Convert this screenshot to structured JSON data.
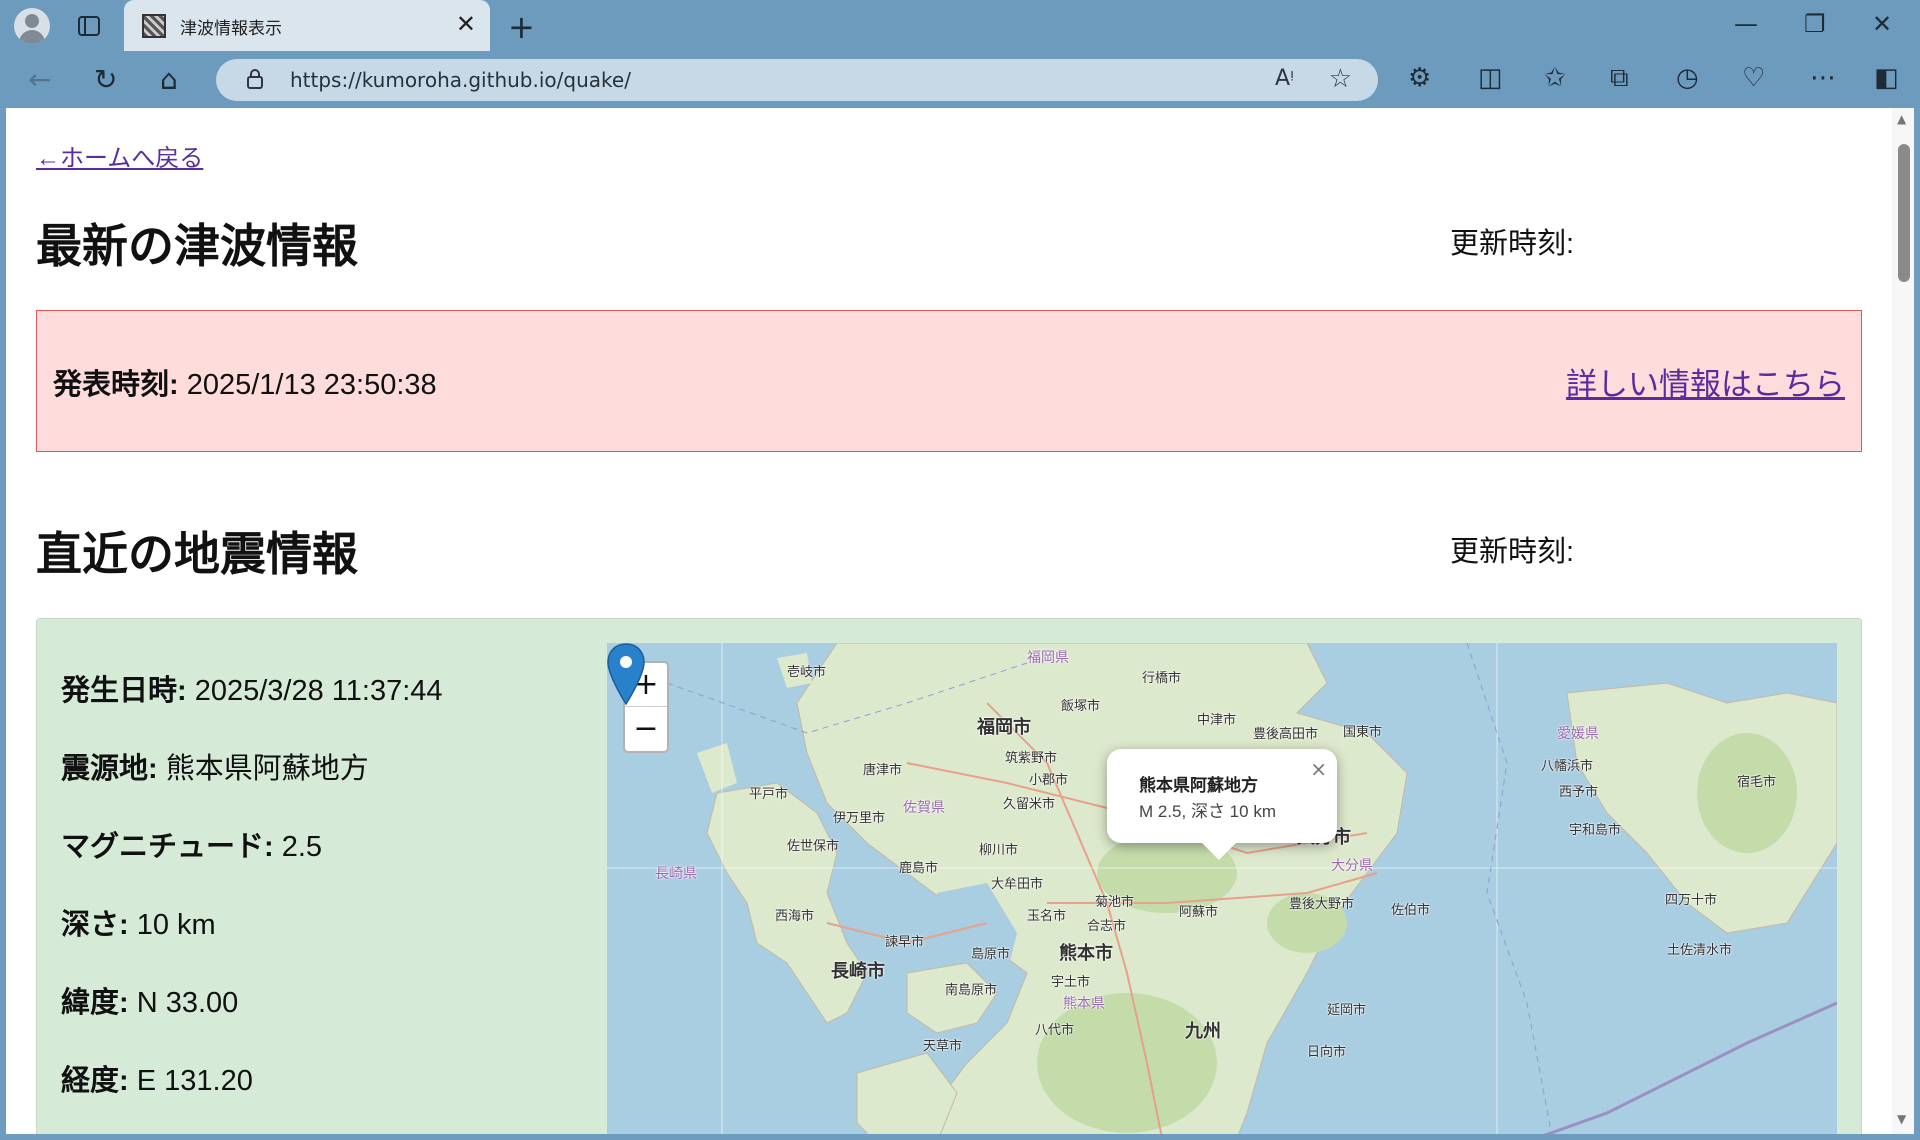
{
  "browser": {
    "tab_title": "津波情報表示",
    "url": "https://kumoroha.github.io/quake/"
  },
  "page": {
    "back_link": "←ホームへ戻る",
    "tsunami": {
      "heading": "最新の津波情報",
      "updated_label": "更新時刻:",
      "issued_label": "発表時刻:",
      "issued_value": "2025/1/13 23:50:38",
      "details_link": "詳しい情報はこちら"
    },
    "quake": {
      "heading": "直近の地震情報",
      "updated_label": "更新時刻:",
      "occurred_label": "発生日時:",
      "occurred_value": "2025/3/28 11:37:44",
      "epicenter_label": "震源地:",
      "epicenter_value": "熊本県阿蘇地方",
      "magnitude_label": "マグニチュード:",
      "magnitude_value": "2.5",
      "depth_label": "深さ:",
      "depth_value": "10 km",
      "latitude_label": "緯度:",
      "latitude_value": "N 33.00",
      "longitude_label": "経度:",
      "longitude_value": "E 131.20"
    },
    "map": {
      "zoom_in": "+",
      "zoom_out": "−",
      "popup_title": "熊本県阿蘇地方",
      "popup_info": "M 2.5, 深さ 10 km",
      "popup_close": "×",
      "labels": {
        "iki": "壱岐市",
        "fukuoka_pref": "福岡県",
        "yukuhashi": "行橋市",
        "fukuoka": "福岡市",
        "iizuka": "飯塚市",
        "nakatsu": "中津市",
        "bungotakada": "豊後高田市",
        "kunisaki": "国東市",
        "karatsu": "唐津市",
        "chikushino": "筑紫野市",
        "ogori": "小郡市",
        "hirado": "平戸市",
        "saga_pref": "佐賀県",
        "kurume": "久留米市",
        "imari": "伊万里市",
        "sasebo": "佐世保市",
        "nagasaki_pref": "長崎県",
        "kashima": "鹿島市",
        "yanagawa": "柳川市",
        "omuta": "大牟田市",
        "kikuchi": "菊池市",
        "aso": "阿蘇市",
        "bungoono": "豊後大野市",
        "saiki": "佐伯市",
        "oita": "大分市",
        "oita_pref": "大分県",
        "saikai": "西海市",
        "isahaya": "諫早市",
        "tamana": "玉名市",
        "koshi": "合志市",
        "nagasaki": "長崎市",
        "shimabara": "島原市",
        "kumamoto": "熊本市",
        "minamishimabara": "南島原市",
        "uto": "宇土市",
        "kumamoto_pref": "熊本県",
        "nobeoka": "延岡市",
        "amakusa": "天草市",
        "yatsushiro": "八代市",
        "kyushu": "九州",
        "hyuga": "日向市",
        "ehime_pref": "愛媛県",
        "yawatahama": "八幡浜市",
        "seiyo": "西予市",
        "uwajima": "宇和島市",
        "sukumo": "宿毛市",
        "shimanto": "四万十市",
        "tosashimizu": "土佐清水市"
      }
    }
  }
}
